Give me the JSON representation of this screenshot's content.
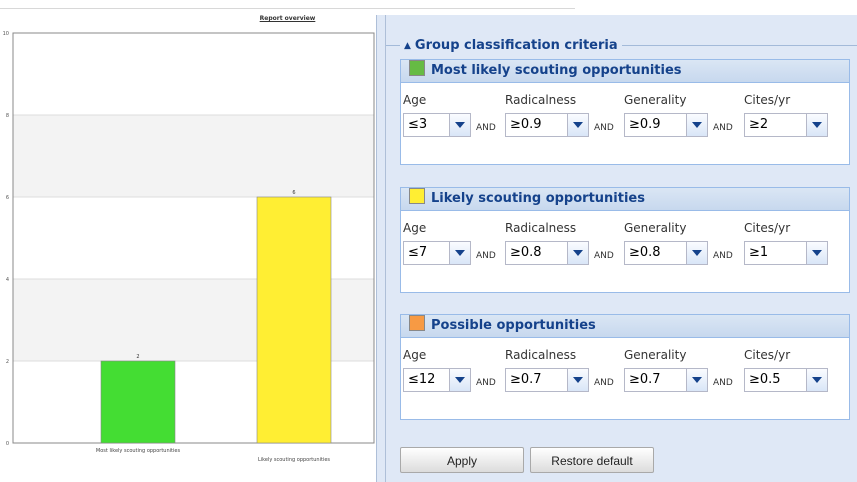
{
  "chart_data": {
    "type": "bar",
    "title": "Report overview",
    "categories": [
      "Most likely scouting opportunities",
      "Likely scouting opportunities"
    ],
    "values": [
      2,
      6
    ],
    "colors": [
      "#44dd33",
      "#ffee33"
    ],
    "data_labels": [
      "2",
      "6"
    ],
    "ylim": [
      0,
      10
    ],
    "yticks": [
      "0",
      "2",
      "4",
      "6",
      "8",
      "10"
    ],
    "grid": "alternating horizontal bands"
  },
  "panel": {
    "section_title": "Group classification criteria",
    "and_label": "AND",
    "groups": [
      {
        "title": "Most likely scouting opportunities",
        "color": "#66bb44",
        "labels": [
          "Age",
          "Radicalness",
          "Generality",
          "Cites/yr"
        ],
        "values": [
          "≤3",
          "≥0.9",
          "≥0.9",
          "≥2"
        ]
      },
      {
        "title": "Likely scouting opportunities",
        "color": "#ffee33",
        "labels": [
          "Age",
          "Radicalness",
          "Generality",
          "Cites/yr"
        ],
        "values": [
          "≤7",
          "≥0.8",
          "≥0.8",
          "≥1"
        ]
      },
      {
        "title": "Possible opportunities",
        "color": "#f79a44",
        "labels": [
          "Age",
          "Radicalness",
          "Generality",
          "Cites/yr"
        ],
        "values": [
          "≤12",
          "≥0.7",
          "≥0.7",
          "≥0.5"
        ]
      }
    ],
    "buttons": {
      "apply": "Apply",
      "restore": "Restore default"
    }
  }
}
